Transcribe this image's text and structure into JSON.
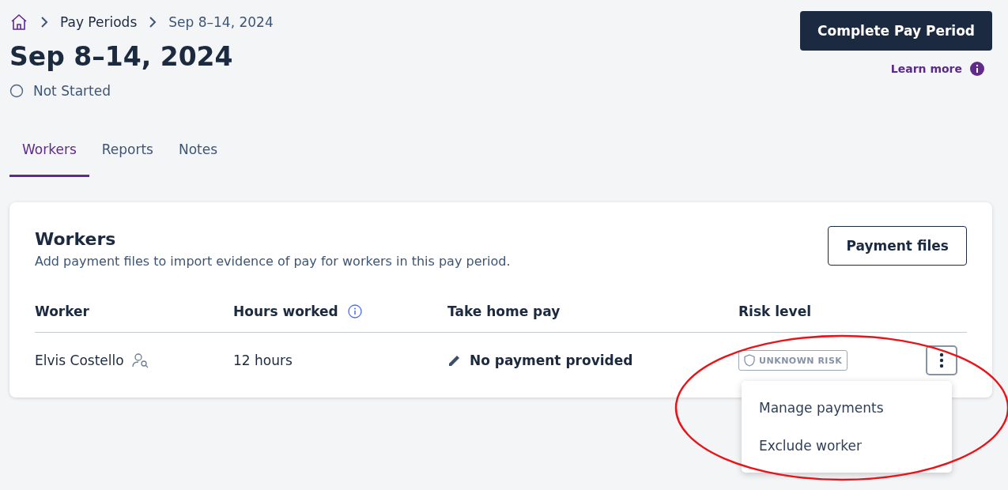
{
  "breadcrumb": [
    {
      "label": "Pay Periods"
    },
    {
      "label": "Sep 8–14, 2024"
    }
  ],
  "title": "Sep 8–14, 2024",
  "status": "Not Started",
  "primary_button": "Complete Pay Period",
  "learn_more": "Learn more",
  "tabs": [
    {
      "label": "Workers",
      "selected": true
    },
    {
      "label": "Reports",
      "selected": false
    },
    {
      "label": "Notes",
      "selected": false
    }
  ],
  "card": {
    "title": "Workers",
    "subtitle": "Add payment files to import evidence of pay for workers in this pay period.",
    "button": "Payment files",
    "columns": [
      "Worker",
      "Hours worked",
      "Take home pay",
      "Risk level"
    ],
    "rows": [
      {
        "worker": "Elvis Costello",
        "hours": "12 hours",
        "pay": "No payment provided",
        "risk": "UNKNOWN RISK",
        "menu_open": true
      }
    ]
  },
  "menu": [
    "Manage payments",
    "Exclude worker"
  ]
}
